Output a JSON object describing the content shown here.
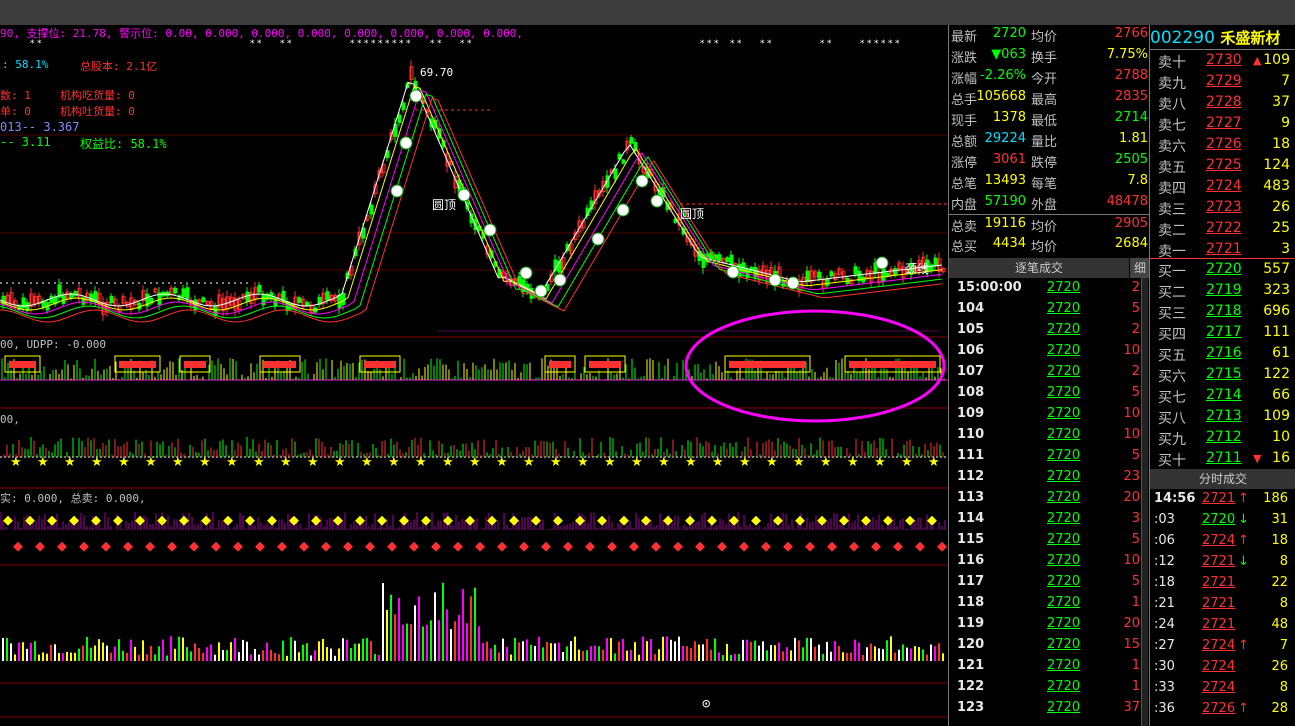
{
  "colors": {
    "up": "#ff3030",
    "down": "#00ff00",
    "yellow": "#ffff00",
    "magenta": "#ff00ff",
    "cyan": "#00e0ff"
  },
  "header": {
    "line1": "90, 支撑位: 21.78, 警示位: 0.00, 0.000, 0.000, 0.000, 0.000, 0.000, 0.000, 0.000,",
    "line2a": ": 58.1%",
    "line2b": "总股本: 2.1亿",
    "line3a": "数: 1",
    "line3b": "机构吃货量: 0",
    "line4a": "单: 0",
    "line4b": "机构吐货量: 0",
    "line5": "013-- 3.367",
    "line6a": "-- 3.11",
    "line6b": "权益比: 58.1%",
    "peak_label": "69.70",
    "ind1": "00, UDPP: -0.000",
    "ind2": "00,",
    "ind3": "实: 0.000, 总卖: 0.000,",
    "bottom_marker": "⊙",
    "indicator_labels": [
      "圆顶",
      "圆顶",
      "颈线",
      "圆顶"
    ]
  },
  "quote": {
    "rows": [
      {
        "l": "最新",
        "v": "2720",
        "vc": "dn",
        "l2": "均价",
        "v2": "2766",
        "v2c": "up"
      },
      {
        "l": "涨跌",
        "v": "▼063",
        "vc": "dn",
        "l2": "换手",
        "v2": "7.75%",
        "v2c": "ye"
      },
      {
        "l": "涨幅",
        "v": "-2.26%",
        "vc": "dn",
        "l2": "今开",
        "v2": "2788",
        "v2c": "up"
      },
      {
        "l": "总手",
        "v": "105668",
        "vc": "ye",
        "l2": "最高",
        "v2": "2835",
        "v2c": "up"
      },
      {
        "l": "现手",
        "v": "1378",
        "vc": "ye",
        "l2": "最低",
        "v2": "2714",
        "v2c": "dn"
      },
      {
        "l": "总额",
        "v": "29224",
        "vc": "cy",
        "l2": "量比",
        "v2": "1.81",
        "v2c": "ye"
      },
      {
        "l": "涨停",
        "v": "3061",
        "vc": "up",
        "l2": "跌停",
        "v2": "2505",
        "v2c": "dn"
      },
      {
        "l": "总笔",
        "v": "13493",
        "vc": "ye",
        "l2": "每笔",
        "v2": "7.8",
        "v2c": "ye"
      },
      {
        "l": "内盘",
        "v": "57190",
        "vc": "dn",
        "l2": "外盘",
        "v2": "48478",
        "v2c": "up"
      },
      {
        "l": "总卖",
        "v": "19116",
        "vc": "ye",
        "l2": "均价",
        "v2": "2905",
        "v2c": "up"
      },
      {
        "l": "总买",
        "v": "4434",
        "vc": "ye",
        "l2": "均价",
        "v2": "2684",
        "v2c": "ye"
      }
    ]
  },
  "ticks": {
    "title": "逐笔成交",
    "tab": "细",
    "rows": [
      {
        "t": "15:00:00",
        "p": "2720",
        "v": "2"
      },
      {
        "t": "104",
        "p": "2720",
        "v": "5"
      },
      {
        "t": "105",
        "p": "2720",
        "v": "2"
      },
      {
        "t": "106",
        "p": "2720",
        "v": "10"
      },
      {
        "t": "107",
        "p": "2720",
        "v": "2"
      },
      {
        "t": "108",
        "p": "2720",
        "v": "5"
      },
      {
        "t": "109",
        "p": "2720",
        "v": "10"
      },
      {
        "t": "110",
        "p": "2720",
        "v": "10"
      },
      {
        "t": "111",
        "p": "2720",
        "v": "5"
      },
      {
        "t": "112",
        "p": "2720",
        "v": "23"
      },
      {
        "t": "113",
        "p": "2720",
        "v": "20"
      },
      {
        "t": "114",
        "p": "2720",
        "v": "3"
      },
      {
        "t": "115",
        "p": "2720",
        "v": "5"
      },
      {
        "t": "116",
        "p": "2720",
        "v": "10"
      },
      {
        "t": "117",
        "p": "2720",
        "v": "5"
      },
      {
        "t": "118",
        "p": "2720",
        "v": "1"
      },
      {
        "t": "119",
        "p": "2720",
        "v": "20"
      },
      {
        "t": "120",
        "p": "2720",
        "v": "15"
      },
      {
        "t": "121",
        "p": "2720",
        "v": "1"
      },
      {
        "t": "122",
        "p": "2720",
        "v": "1"
      },
      {
        "t": "123",
        "p": "2720",
        "v": "37"
      }
    ]
  },
  "book": {
    "code": "002290",
    "name": "禾盛新材",
    "asks": [
      {
        "l": "卖十",
        "p": "2730",
        "a": "▲",
        "v": "109"
      },
      {
        "l": "卖九",
        "p": "2729",
        "v": "7"
      },
      {
        "l": "卖八",
        "p": "2728",
        "v": "37"
      },
      {
        "l": "卖七",
        "p": "2727",
        "v": "9"
      },
      {
        "l": "卖六",
        "p": "2726",
        "v": "18"
      },
      {
        "l": "卖五",
        "p": "2725",
        "v": "124"
      },
      {
        "l": "卖四",
        "p": "2724",
        "v": "483"
      },
      {
        "l": "卖三",
        "p": "2723",
        "v": "26"
      },
      {
        "l": "卖二",
        "p": "2722",
        "v": "25"
      },
      {
        "l": "卖一",
        "p": "2721",
        "v": "3"
      }
    ],
    "bids": [
      {
        "l": "买一",
        "p": "2720",
        "v": "557"
      },
      {
        "l": "买二",
        "p": "2719",
        "v": "323"
      },
      {
        "l": "买三",
        "p": "2718",
        "v": "696"
      },
      {
        "l": "买四",
        "p": "2717",
        "v": "111"
      },
      {
        "l": "买五",
        "p": "2716",
        "v": "61"
      },
      {
        "l": "买六",
        "p": "2715",
        "v": "122"
      },
      {
        "l": "买七",
        "p": "2714",
        "v": "66"
      },
      {
        "l": "买八",
        "p": "2713",
        "v": "109"
      },
      {
        "l": "买九",
        "p": "2712",
        "v": "10"
      },
      {
        "l": "买十",
        "p": "2711",
        "a": "▼",
        "v": "16"
      }
    ],
    "shares_title": "分时成交",
    "shares": [
      {
        "t": "14:56",
        "p": "2721",
        "a": "↑",
        "ac": "up",
        "v": "186"
      },
      {
        "t": ":03",
        "p": "2720",
        "a": "↓",
        "ac": "dn",
        "v": "31"
      },
      {
        "t": ":06",
        "p": "2724",
        "a": "↑",
        "ac": "up",
        "v": "18"
      },
      {
        "t": ":12",
        "p": "2721",
        "a": "↓",
        "ac": "dn",
        "v": "8"
      },
      {
        "t": ":18",
        "p": "2721",
        "v": "22"
      },
      {
        "t": ":21",
        "p": "2721",
        "v": "8"
      },
      {
        "t": ":24",
        "p": "2721",
        "v": "48"
      },
      {
        "t": ":27",
        "p": "2724",
        "a": "↑",
        "ac": "up",
        "v": "7"
      },
      {
        "t": ":30",
        "p": "2724",
        "v": "26"
      },
      {
        "t": ":33",
        "p": "2724",
        "v": "8"
      },
      {
        "t": ":36",
        "p": "2726",
        "a": "↑",
        "ac": "up",
        "v": "28"
      }
    ]
  }
}
